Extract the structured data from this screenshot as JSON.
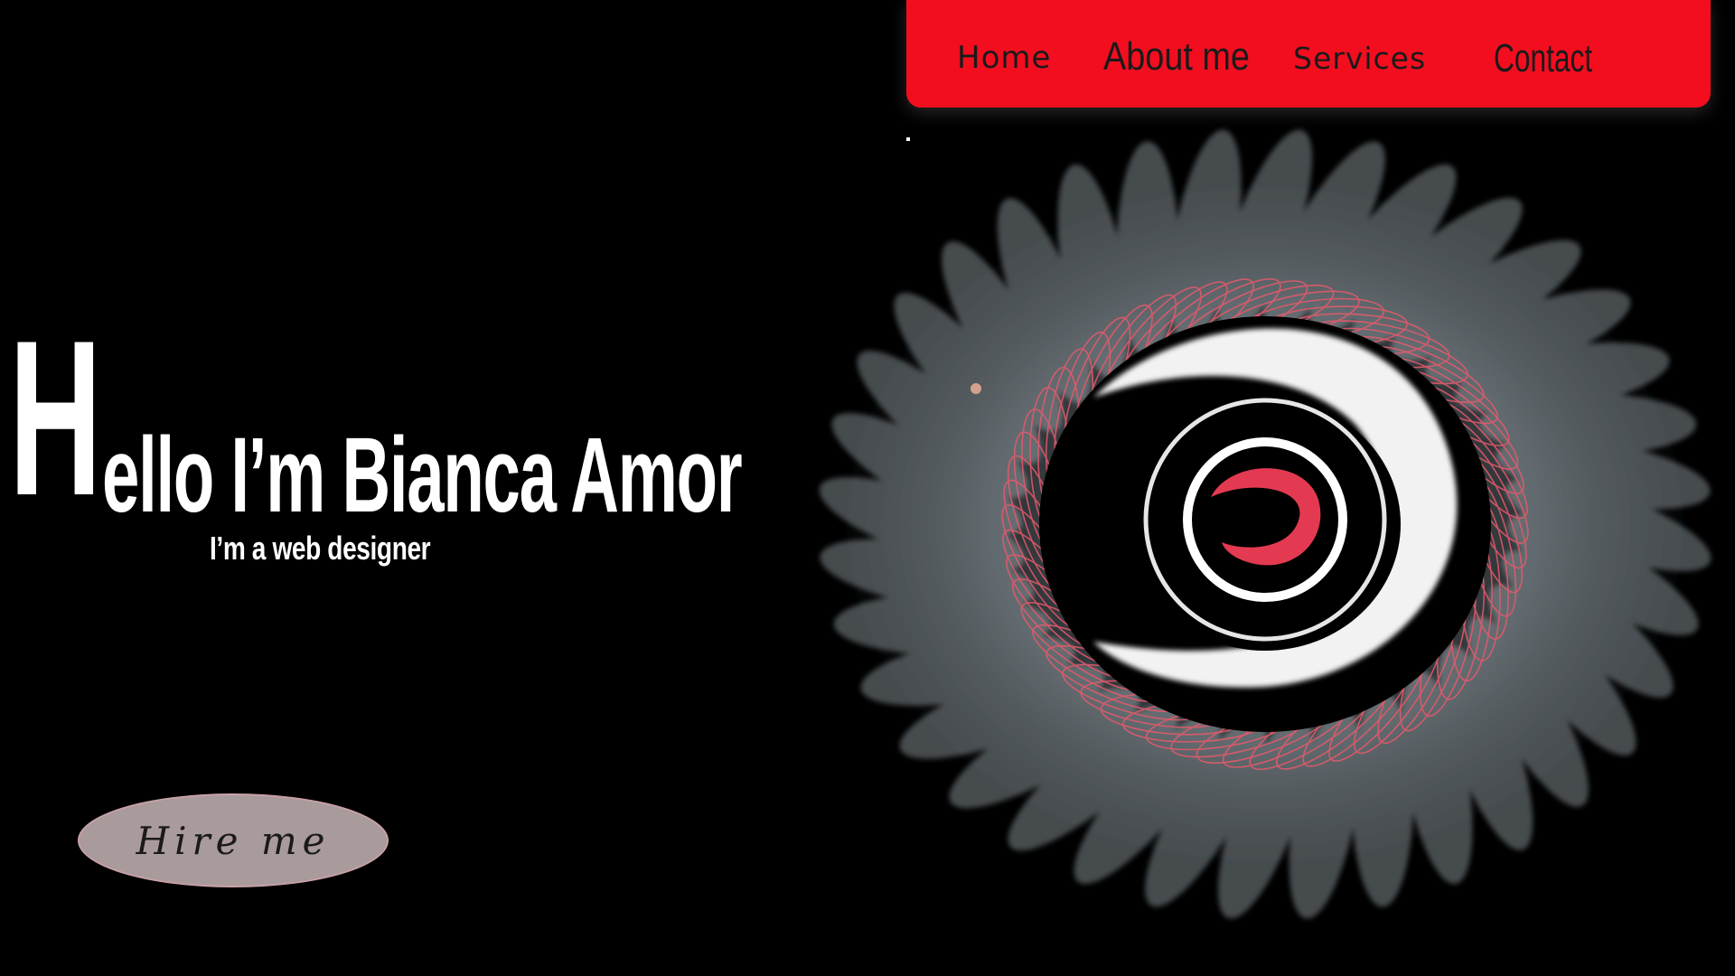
{
  "nav": {
    "items": [
      {
        "label": "Home"
      },
      {
        "label": "About me"
      },
      {
        "label": "Services"
      },
      {
        "label": "Contact"
      }
    ]
  },
  "hero": {
    "heading_initial": "H",
    "heading_rest": "ello I’m Bianca Amor",
    "subtitle": "I’m a web designer",
    "cta_label": "Hire me"
  },
  "art": {
    "icon": "spiral-swirl-artwork"
  },
  "colors": {
    "background": "#000000",
    "nav_bg": "#f20e1f",
    "accent_red": "#e8394b",
    "cta_bg": "#a99a9c",
    "text": "#ffffff"
  }
}
